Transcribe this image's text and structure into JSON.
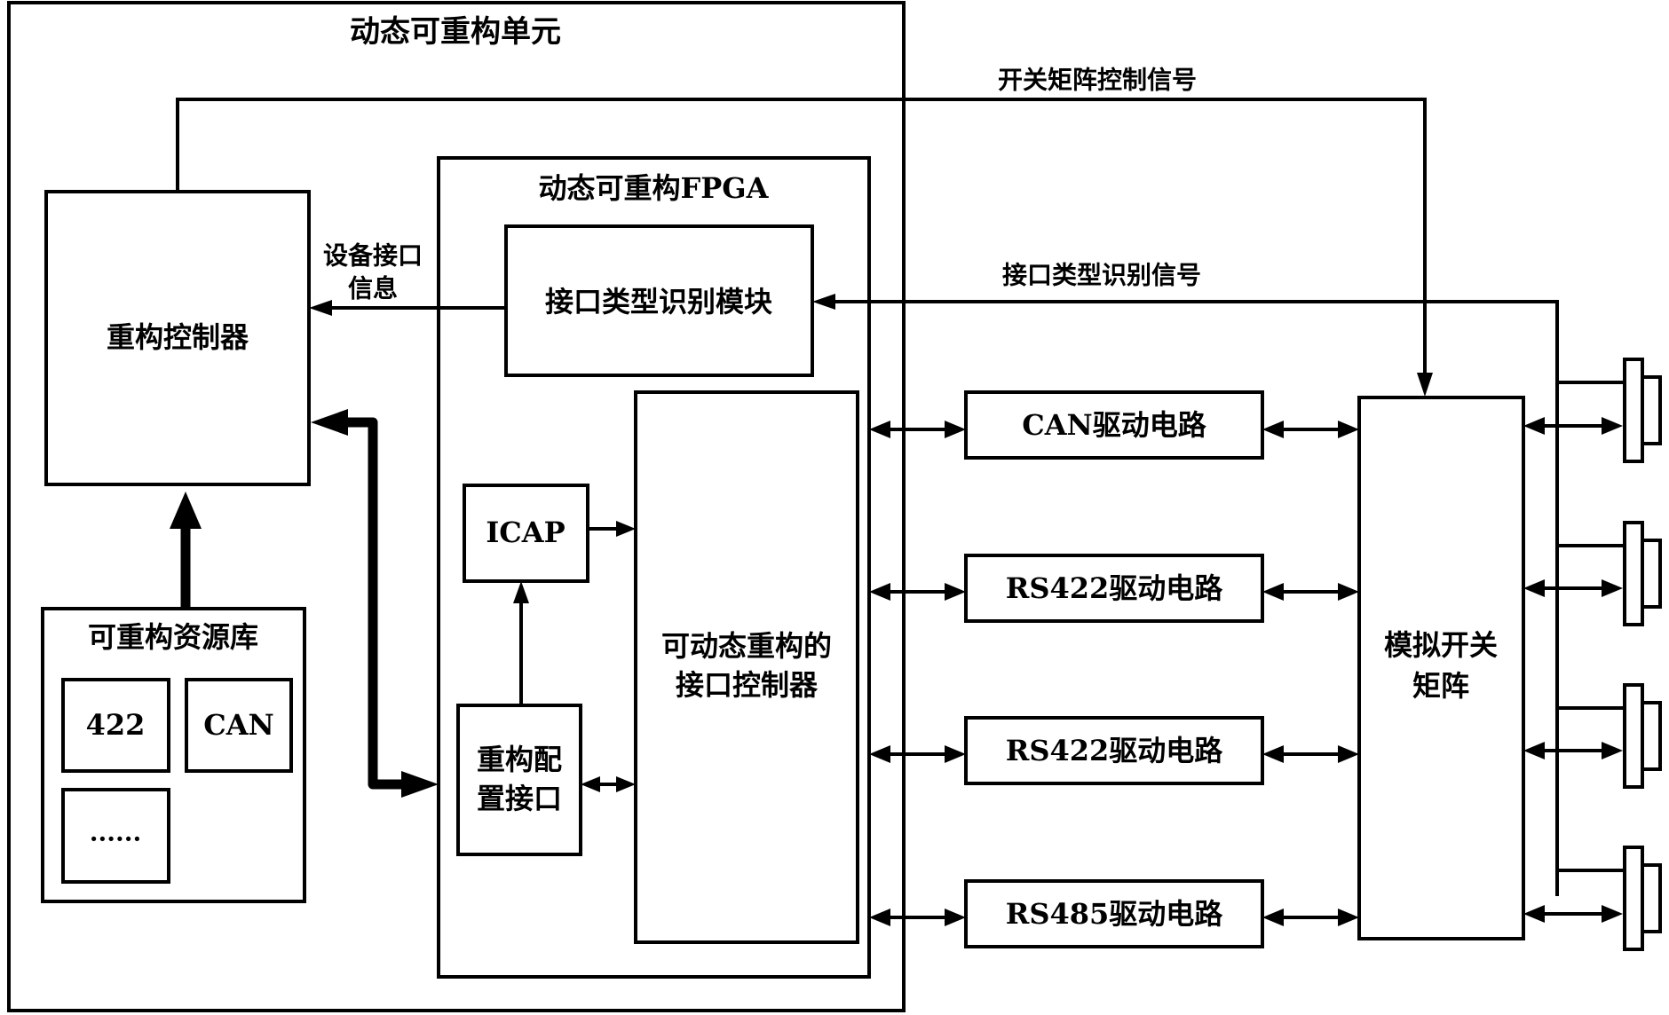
{
  "diagram": {
    "unit_title": "动态可重构单元",
    "reconfig_controller": "重构控制器",
    "resource_library": {
      "title": "可重构资源库",
      "items": [
        "422",
        "CAN",
        "......"
      ]
    },
    "fpga": {
      "title": "动态可重构FPGA",
      "id_module": "接口类型识别模块",
      "icap": "ICAP",
      "config_interface": [
        "重构配",
        "置接口"
      ],
      "interface_controller": [
        "可动态重构的",
        "接口控制器"
      ]
    },
    "labels": {
      "device_interface_info": [
        "设备接口",
        "信息"
      ],
      "switch_matrix_control_signal": "开关矩阵控制信号",
      "interface_type_id_signal": "接口类型识别信号"
    },
    "drivers": [
      "CAN驱动电路",
      "RS422驱动电路",
      "RS422驱动电路",
      "RS485驱动电路"
    ],
    "switch_matrix": [
      "模拟开关",
      "矩阵"
    ],
    "connectors": [
      "connector-1",
      "connector-2",
      "connector-3",
      "connector-4"
    ]
  }
}
